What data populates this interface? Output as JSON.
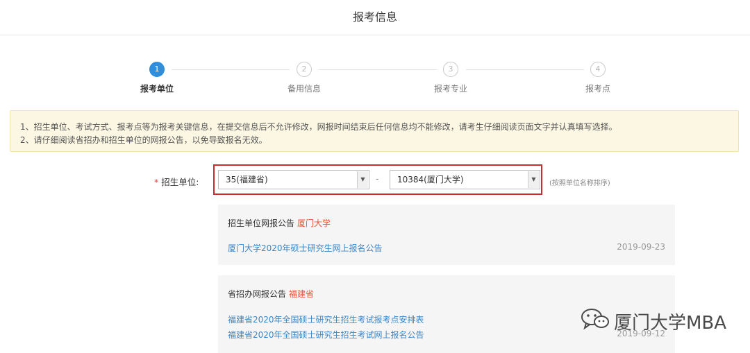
{
  "header": {
    "title": "报考信息"
  },
  "steps": [
    {
      "number": "1",
      "label": "报考单位"
    },
    {
      "number": "2",
      "label": "备用信息"
    },
    {
      "number": "3",
      "label": "报考专业"
    },
    {
      "number": "4",
      "label": "报考点"
    }
  ],
  "notice": {
    "lines": [
      "1、招生单位、考试方式、报考点等为报考关键信息，在提交信息后不允许修改，网报时间结束后任何信息均不能修改，请考生仔细阅读页面文字并认真填写选择。",
      "2、请仔细阅读省招办和招生单位的网报公告，以免导致报名无效。"
    ]
  },
  "form": {
    "required_mark": "*",
    "label": "招生单位:",
    "province_value": "35(福建省)",
    "separator": "-",
    "unit_value": "10384(厦门大学)",
    "hint": "(按照单位名称排序)"
  },
  "unit_announcements": {
    "title": "招生单位网报公告",
    "highlight": "厦门大学",
    "items": [
      {
        "text": "厦门大学2020年硕士研究生网上报名公告",
        "date": "2019-09-23"
      }
    ]
  },
  "province_announcements": {
    "title": "省招办网报公告",
    "highlight": "福建省",
    "items": [
      {
        "text": "福建省2020年全国硕士研究生招生考试报考点安排表",
        "date": ""
      },
      {
        "text": "福建省2020年全国硕士研究生招生考试网上报名公告",
        "date": "2019-09-12"
      }
    ]
  },
  "watermark": {
    "text": "厦门大学MBA",
    "icon": "wechat-icon"
  },
  "colors": {
    "accent": "#2f8fdd",
    "highlight_red": "#e5553b",
    "link_blue": "#3a85c6",
    "frame_red": "#c62d2d",
    "notice_bg": "#fcf7e3"
  }
}
